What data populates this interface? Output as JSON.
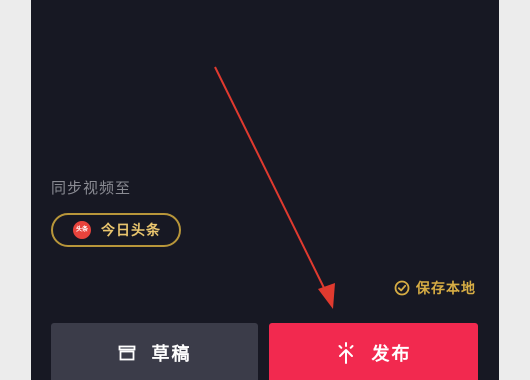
{
  "sync": {
    "label": "同步视频至"
  },
  "toutiao": {
    "logo_text": "头条",
    "label": "今日头条"
  },
  "save_local": {
    "label": "保存本地",
    "icon": "check-circle-icon"
  },
  "actions": {
    "draft_label": "草稿",
    "draft_icon": "draft-box-icon",
    "publish_label": "发布",
    "publish_icon": "upload-arrow-icon"
  },
  "colors": {
    "background": "#171823",
    "publish": "#f2294f",
    "draft": "#3b3c49",
    "gold": "#d7ad44",
    "annotation_arrow": "#e03a2f"
  }
}
